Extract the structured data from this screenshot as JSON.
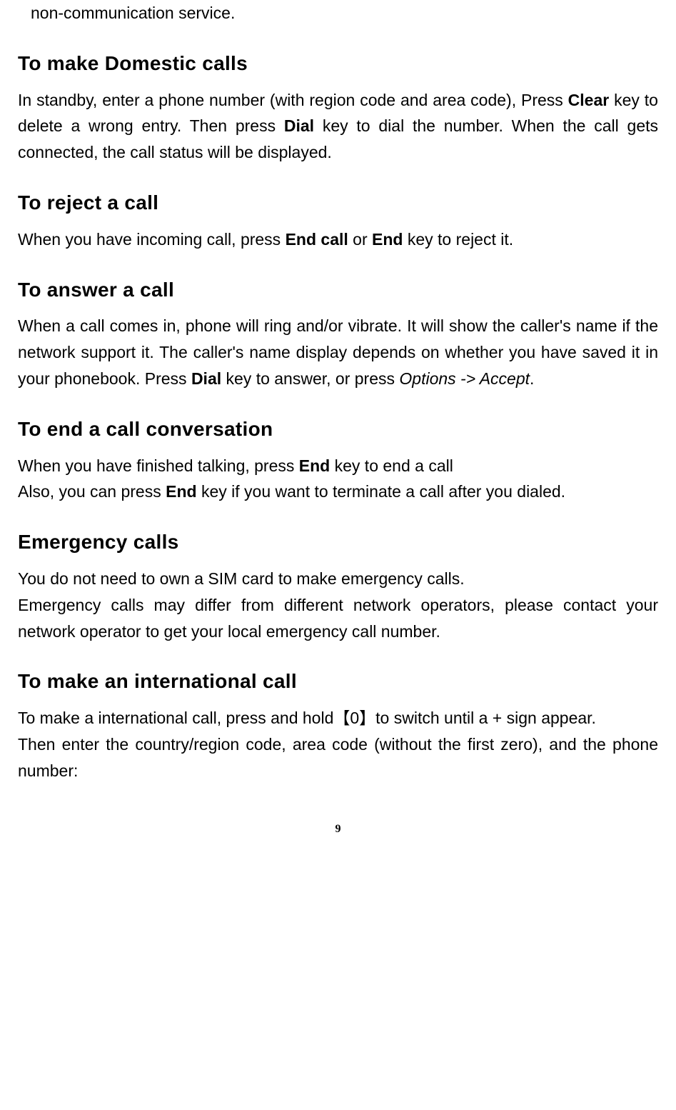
{
  "fragment_top": "non-communication service.",
  "sections": {
    "domestic": {
      "heading": "To make Domestic calls",
      "body_parts": [
        "In standby, enter a phone number (with region code and area code), Press ",
        "Clear",
        " key to delete a wrong entry. Then press ",
        "Dial",
        " key to dial the number. When the call gets connected, the call status will be displayed."
      ]
    },
    "reject": {
      "heading": "To reject a call",
      "body_parts": [
        "When you have incoming call, press ",
        "End call",
        " or ",
        "End",
        " key to reject it."
      ]
    },
    "answer": {
      "heading": "To answer a call",
      "body_parts": [
        "When a call comes in, phone will ring and/or vibrate. It will show the caller's name if the network support it. The caller's name display depends on whether you have saved it in your phonebook. Press ",
        "Dial",
        " key to answer, or press ",
        "Options -> Accept",
        "."
      ]
    },
    "end": {
      "heading": "To end a call conversation",
      "line1_parts": [
        "When you have finished talking, press ",
        "End",
        " key to end a call"
      ],
      "line2_parts": [
        "Also, you can press ",
        "End",
        " key if you want to terminate a call after you dialed."
      ]
    },
    "emergency": {
      "heading": "Emergency calls",
      "line1": "You do not need to own a SIM card to make emergency calls.",
      "line2": "Emergency calls may differ from different network operators, please contact your network operator to get your local emergency call number."
    },
    "international": {
      "heading": "To make an international call",
      "line1": "To make a international call, press and hold【0】to switch until a + sign appear.",
      "line2": "Then enter the country/region code, area code (without the first zero), and the phone number:"
    }
  },
  "page_number": "9"
}
